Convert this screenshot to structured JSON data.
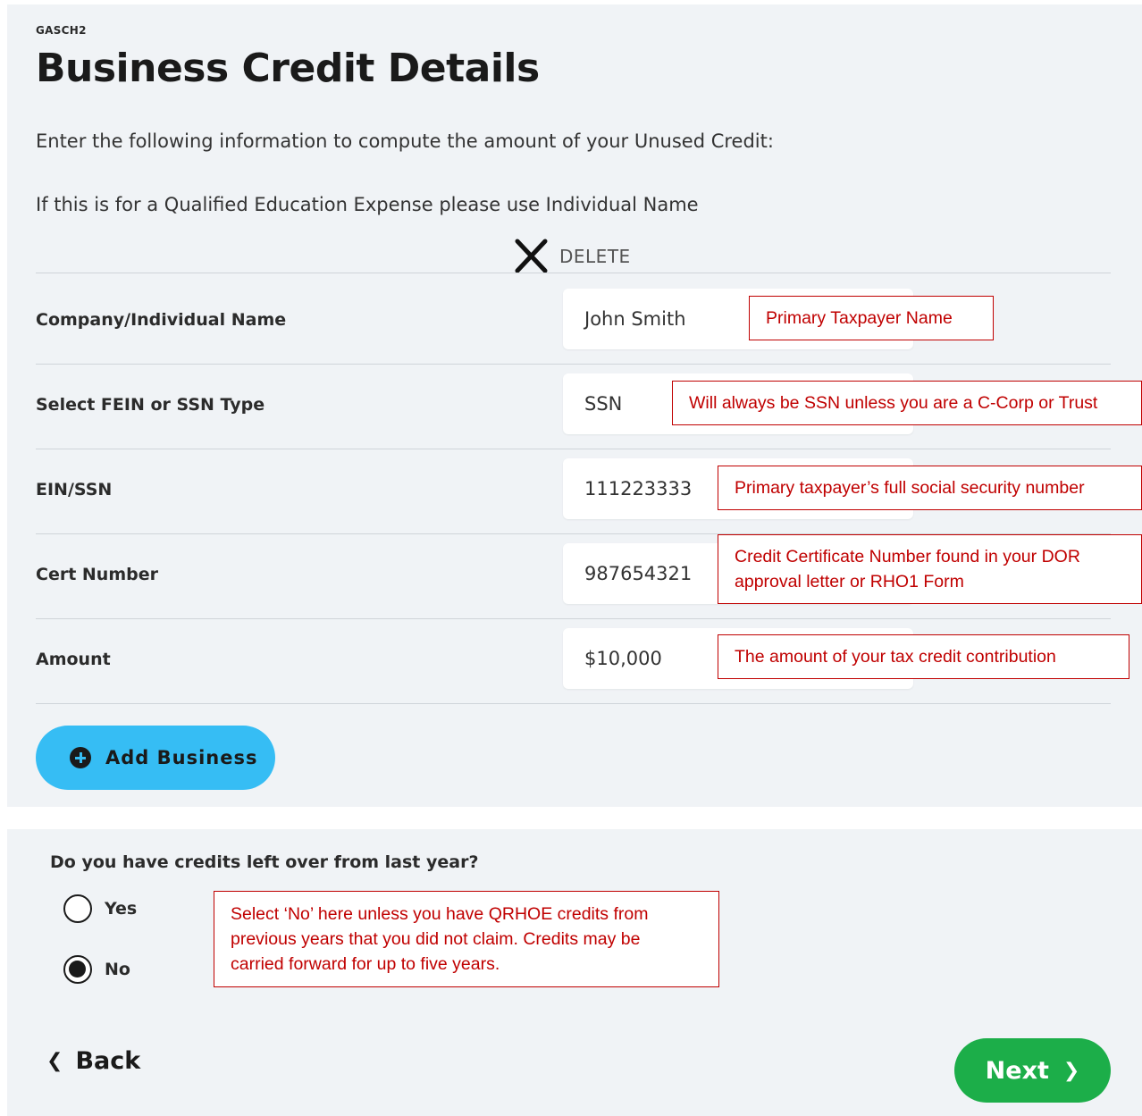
{
  "header": {
    "form_code": "GASCH2",
    "title": "Business Credit Details",
    "intro": "Enter the following information to compute the amount of your Unused Credit:",
    "note": "If this is for a Qualified Education Expense please use Individual Name",
    "delete_label": "DELETE"
  },
  "fields": [
    {
      "label": "Company/Individual Name",
      "value": "John Smith"
    },
    {
      "label": "Select FEIN or SSN Type",
      "value": "SSN"
    },
    {
      "label": "EIN/SSN",
      "value": "111223333"
    },
    {
      "label": "Cert Number",
      "value": "987654321"
    },
    {
      "label": "Amount",
      "value": "$10,000"
    }
  ],
  "callouts": {
    "name": "Primary Taxpayer Name",
    "type": "Will always be SSN unless you are a C-Corp or Trust",
    "ssn": "Primary taxpayer’s full social security number",
    "cert_line1": "Credit Certificate Number found in your DOR",
    "cert_line2": "approval letter or RHO1 Form",
    "amount": "The amount of your tax credit contribution",
    "carry_line1": "Select ‘No’ here unless you have QRHOE credits from",
    "carry_line2": "previous years that you did not claim. Credits may be",
    "carry_line3": "carried forward for up to five years."
  },
  "add_business_label": "Add Business",
  "carryover": {
    "question": "Do you have credits left over from last year?",
    "options": [
      {
        "label": "Yes",
        "selected": false
      },
      {
        "label": "No",
        "selected": true
      }
    ]
  },
  "nav": {
    "back_label": "Back",
    "next_label": "Next"
  },
  "colors": {
    "panel_bg": "#f0f3f6",
    "add_button": "#36bdf4",
    "next_button": "#1cae49",
    "callout_red": "#c00000"
  },
  "icons": {
    "delete": "close-icon",
    "add": "plus-circle-icon",
    "back": "chevron-left-icon",
    "next": "chevron-right-icon"
  }
}
